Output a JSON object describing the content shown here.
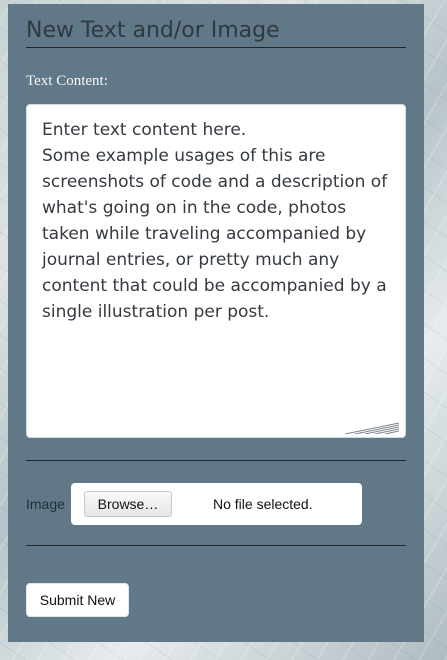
{
  "form": {
    "title": "New Text and/or Image",
    "text_label": "Text Content:",
    "text_value": "Enter text content here.\nSome example usages of this are screenshots of code and a description of what's going on in the code, photos taken while traveling accompanied by journal entries, or pretty much any content that could be accompanied by a single illustration per post.",
    "image_label": "Image",
    "browse_label": "Browse…",
    "file_status": "No file selected.",
    "submit_label": "Submit New"
  },
  "colors": {
    "panel": "#607888",
    "input_background": "#ffffff",
    "title_text": "#2f3a40",
    "divider": "#1f2529"
  },
  "icons": {
    "resize_handle": "textarea-resize-icon"
  }
}
